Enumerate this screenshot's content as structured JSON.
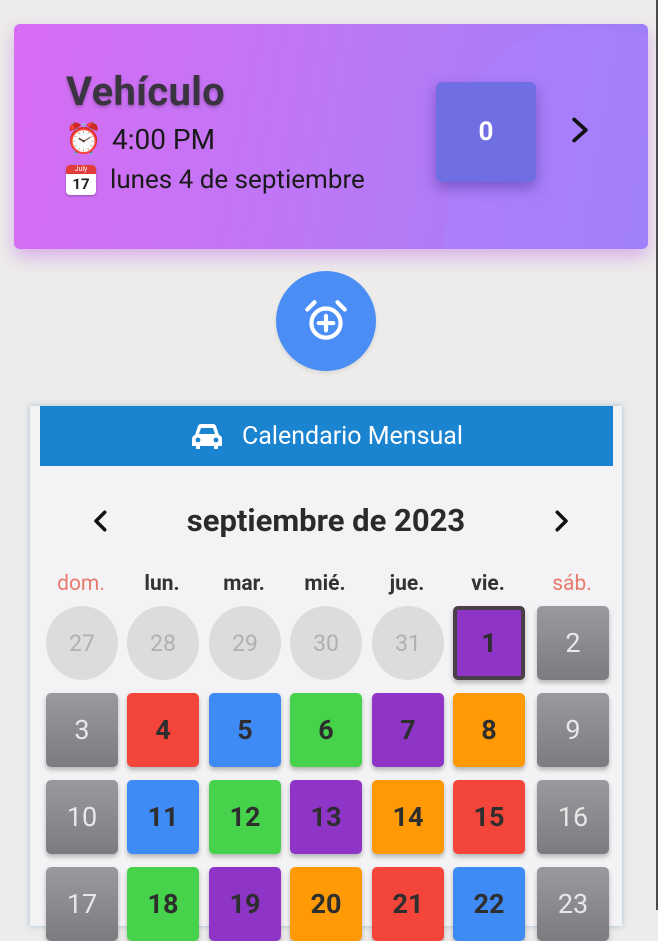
{
  "event_card": {
    "title": "Vehículo",
    "time_icon": "alarm-clock-icon",
    "time": "4:00 PM",
    "date_icon": "calendar-icon",
    "date_icon_month": "July",
    "date_icon_day": "17",
    "date": "lunes 4 de septiembre",
    "counter": "0"
  },
  "calendar": {
    "header_icon": "car-icon",
    "header_title": "Calendario Mensual",
    "month_title": "septiembre de 2023",
    "weekdays": [
      "dom.",
      "lun.",
      "mar.",
      "mié.",
      "jue.",
      "vie.",
      "sáb."
    ],
    "days": [
      {
        "label": "27",
        "kind": "prev"
      },
      {
        "label": "28",
        "kind": "prev"
      },
      {
        "label": "29",
        "kind": "prev"
      },
      {
        "label": "30",
        "kind": "prev"
      },
      {
        "label": "31",
        "kind": "prev"
      },
      {
        "label": "1",
        "kind": "event",
        "color": "#8e35c8",
        "today": true
      },
      {
        "label": "2",
        "kind": "weekend"
      },
      {
        "label": "3",
        "kind": "weekend"
      },
      {
        "label": "4",
        "kind": "event",
        "color": "#f4453a"
      },
      {
        "label": "5",
        "kind": "event",
        "color": "#3f8bf6"
      },
      {
        "label": "6",
        "kind": "event",
        "color": "#46d24a"
      },
      {
        "label": "7",
        "kind": "event",
        "color": "#8e35c8"
      },
      {
        "label": "8",
        "kind": "event",
        "color": "#ff9a05"
      },
      {
        "label": "9",
        "kind": "weekend"
      },
      {
        "label": "10",
        "kind": "weekend"
      },
      {
        "label": "11",
        "kind": "event",
        "color": "#3f8bf6"
      },
      {
        "label": "12",
        "kind": "event",
        "color": "#46d24a"
      },
      {
        "label": "13",
        "kind": "event",
        "color": "#8e35c8"
      },
      {
        "label": "14",
        "kind": "event",
        "color": "#ff9a05"
      },
      {
        "label": "15",
        "kind": "event",
        "color": "#f4453a"
      },
      {
        "label": "16",
        "kind": "weekend"
      },
      {
        "label": "17",
        "kind": "weekend"
      },
      {
        "label": "18",
        "kind": "event",
        "color": "#46d24a"
      },
      {
        "label": "19",
        "kind": "event",
        "color": "#8e35c8"
      },
      {
        "label": "20",
        "kind": "event",
        "color": "#ff9a05"
      },
      {
        "label": "21",
        "kind": "event",
        "color": "#f4453a"
      },
      {
        "label": "22",
        "kind": "event",
        "color": "#3f8bf6"
      },
      {
        "label": "23",
        "kind": "weekend"
      }
    ]
  },
  "colors": {
    "card_gradient_start": "#d86cf4",
    "card_gradient_end": "#9b7ef8",
    "fab": "#4a8ef5",
    "calendar_header": "#1a84d0"
  }
}
